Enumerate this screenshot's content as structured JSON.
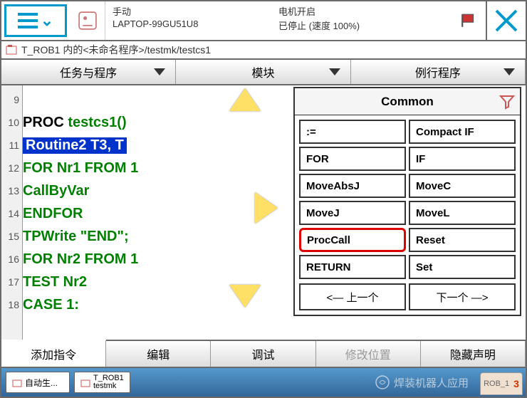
{
  "header": {
    "mode": "手动",
    "device": "LAPTOP-99GU51U8",
    "motor": "电机开启",
    "stopped": "已停止 (速度 100%)"
  },
  "path": {
    "text": "T_ROB1 内的<未命名程序>/testmk/testcs1"
  },
  "tabs": {
    "task": "任务与程序",
    "module": "模块",
    "routine": "例行程序"
  },
  "code": {
    "lines": [
      "9",
      "10",
      "11",
      "12",
      "13",
      "14",
      "15",
      "16",
      "17",
      "18"
    ],
    "l9": "",
    "l10_a": "PROC ",
    "l10_b": "testcs1()",
    "l11_sel": "Routine2 T3, T",
    "l12": "FOR Nr1 FROM 1",
    "l13": "CallByVar ",
    "l14": "ENDFOR",
    "l15": "TPWrite \"END\";",
    "l16": "FOR Nr2 FROM 1",
    "l17": "TEST Nr2",
    "l18": "CASE 1:"
  },
  "panel": {
    "title": "Common",
    "cmds": [
      ":=",
      "Compact IF",
      "FOR",
      "IF",
      "MoveAbsJ",
      "MoveC",
      "MoveJ",
      "MoveL",
      "ProcCall",
      "Reset",
      "RETURN",
      "Set"
    ],
    "prev": "<— 上一个",
    "next": "下一个 —>"
  },
  "bottomTabs": {
    "add": "添加指令",
    "edit": "编辑",
    "debug": "调试",
    "modpos": "修改位置",
    "hide": "隐藏声明"
  },
  "taskbar": {
    "t1": "自动生...",
    "t2a": "T_ROB1",
    "t2b": "testmk",
    "watermark": "焊装机器人应用",
    "corner": "3"
  }
}
